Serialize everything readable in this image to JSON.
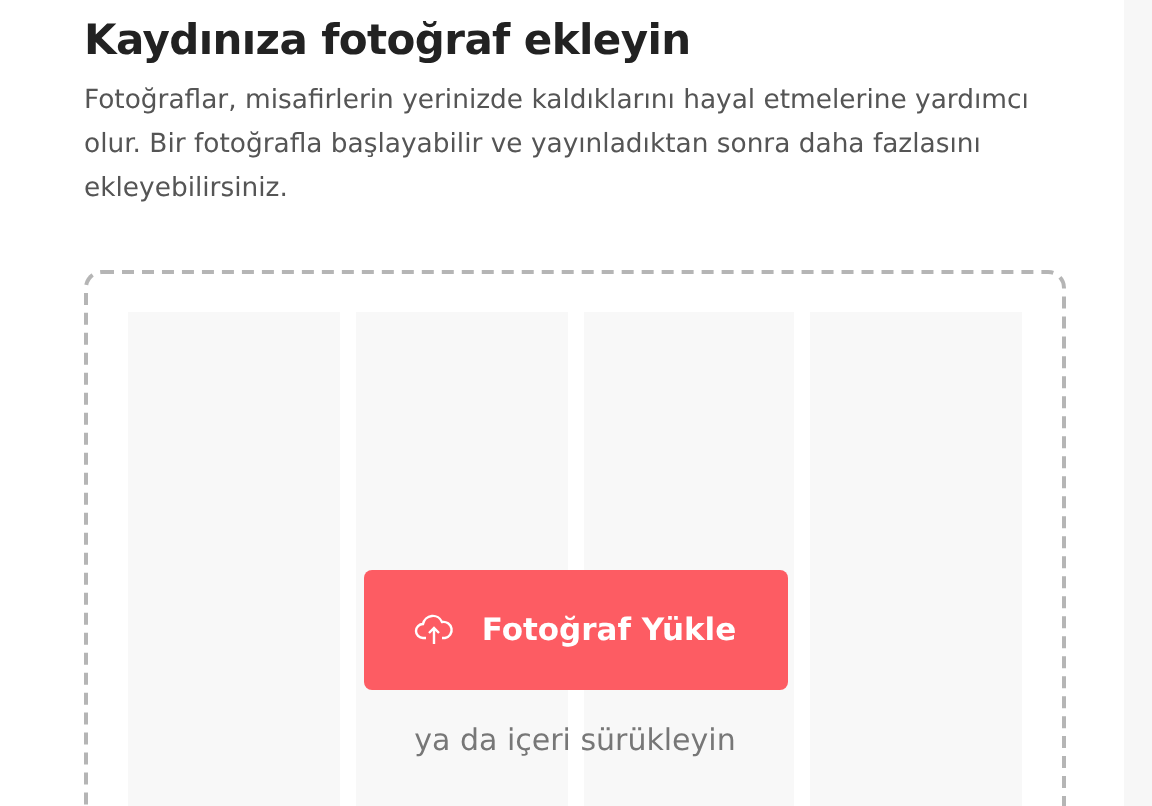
{
  "heading": "Kaydınıza fotoğraf ekleyin",
  "description": "Fotoğraflar, misafirlerin yerinizde kaldıklarını hayal etmelerine yardımcı olur. Bir fotoğrafla başlayabilir ve yayınladıktan sonra daha fazlasını ekleyebilirsiniz.",
  "dropzone": {
    "slots": [
      {
        "kind": "empty"
      },
      {
        "kind": "empty"
      },
      {
        "kind": "empty"
      },
      {
        "kind": "empty"
      }
    ],
    "button": "Fotoğraf Yükle",
    "hint": "ya da içeri sürükleyin"
  }
}
